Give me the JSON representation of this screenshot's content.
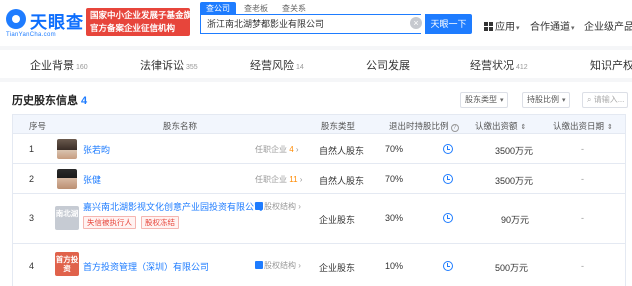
{
  "header": {
    "logo_text": "天眼查",
    "logo_sub": "TianYanCha.com",
    "banner_lines": [
      "国家中小企业发展子基金旗下",
      "官方备案企业征信机构"
    ],
    "search_tabs": [
      "查公司",
      "查老板",
      "查关系"
    ],
    "search_value": "浙江南北湖梦都影业有限公司",
    "search_button": "天眼一下",
    "nav": [
      "应用",
      "合作通道",
      "企业级产品"
    ]
  },
  "tabs": [
    {
      "label": "企业背景",
      "count": "160"
    },
    {
      "label": "法律诉讼",
      "count": "355"
    },
    {
      "label": "经营风险",
      "count": "14"
    },
    {
      "label": "公司发展",
      "count": ""
    },
    {
      "label": "经营状况",
      "count": "412"
    },
    {
      "label": "知识产权",
      "count": ""
    }
  ],
  "section": {
    "title": "历史股东信息",
    "count": "4",
    "filters": {
      "type": "股东类型",
      "ratio": "持股比例",
      "search_placeholder": "请输入..."
    }
  },
  "table": {
    "headers": [
      "序号",
      "股东名称",
      "股东类型",
      "退出时持股比例",
      "认缴出资额",
      "认缴出资日期"
    ],
    "rows": [
      {
        "idx": "1",
        "name": "张若昀",
        "meta_prefix": "任职企业",
        "meta_count": "4",
        "type": "自然人股东",
        "ratio": "70%",
        "amount": "3500万元",
        "date": "-"
      },
      {
        "idx": "2",
        "name": "张健",
        "meta_prefix": "任职企业",
        "meta_count": "11",
        "type": "自然人股东",
        "ratio": "70%",
        "amount": "3500万元",
        "date": "-"
      },
      {
        "idx": "3",
        "name": "嘉兴南北湖影视文化创意产业园投资有限公司",
        "avatar_text": "南北湖",
        "equity": "股权结构",
        "tags": [
          "失信被执行人",
          "股权冻结"
        ],
        "type": "企业股东",
        "ratio": "30%",
        "amount": "90万元",
        "date": "-"
      },
      {
        "idx": "4",
        "name": "首方投资管理（深圳）有限公司",
        "avatar_text": "首方投资",
        "equity": "股权结构",
        "type": "企业股东",
        "ratio": "10%",
        "amount": "500万元",
        "date": "-"
      }
    ]
  }
}
